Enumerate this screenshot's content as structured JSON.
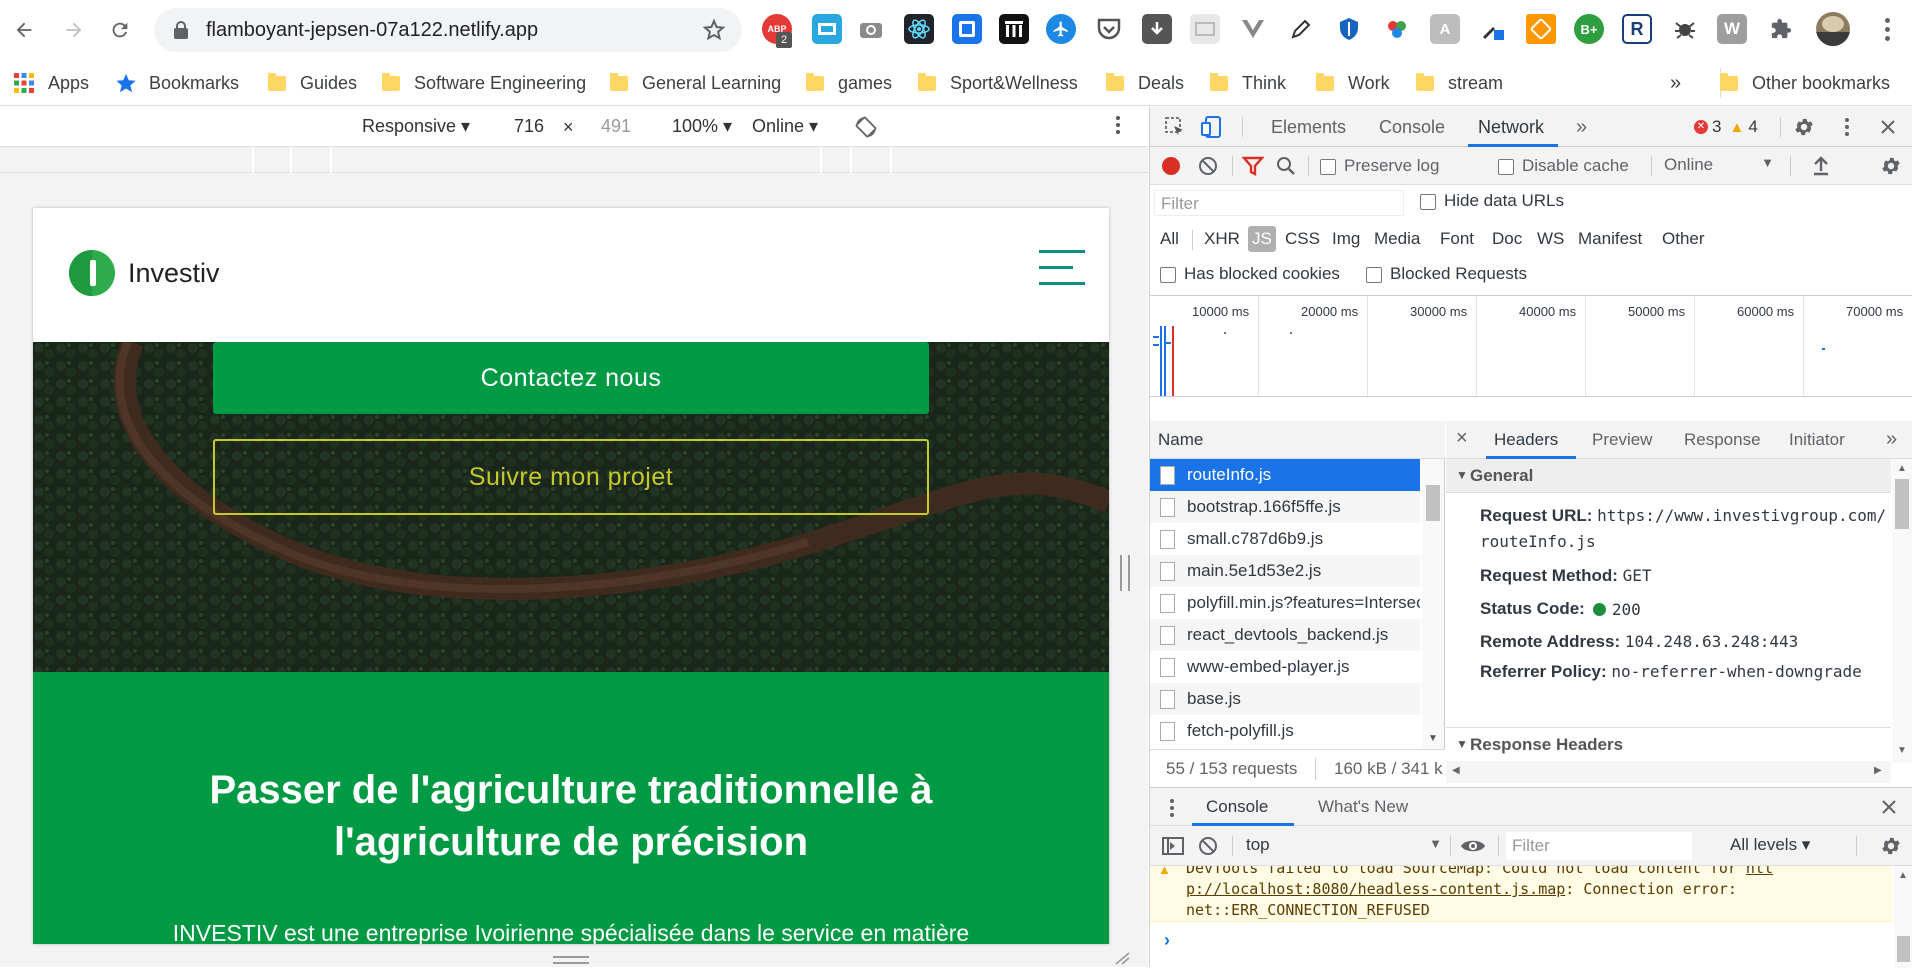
{
  "browser": {
    "url": "flamboyant-jepsen-07a122.netlify.app",
    "ext_badges": [
      {
        "name": "adblock",
        "text": "ABP",
        "badge": "2",
        "color": "#e53935"
      },
      {
        "name": "ext-2",
        "color": "#1a73e8"
      },
      {
        "name": "camera",
        "color": "#777"
      },
      {
        "name": "react-devtools",
        "color": "#222"
      },
      {
        "name": "ext-5",
        "color": "#1a73e8"
      },
      {
        "name": "ext-6",
        "color": "#222"
      },
      {
        "name": "ext-7",
        "color": "#1e88e5"
      },
      {
        "name": "pocket",
        "color": "#555"
      },
      {
        "name": "ext-9",
        "color": "#555"
      }
    ],
    "ext_letters": {
      "b_plus": "B+",
      "r": "R",
      "w": "W"
    }
  },
  "bookmarks": {
    "apps": "Apps",
    "bookmarks": "Bookmarks",
    "folders": [
      "Guides",
      "Software Engineering",
      "General Learning",
      "games",
      "Sport&Wellness",
      "Deals",
      "Think",
      "Work",
      "stream"
    ],
    "more": "»",
    "other": "Other bookmarks"
  },
  "device_toolbar": {
    "mode": "Responsive ▾",
    "width": "716",
    "times": "×",
    "height": "491",
    "zoom": "100% ▾",
    "network": "Online ▾"
  },
  "site": {
    "brand": "Investiv",
    "contact_btn": "Contactez nous",
    "follow_btn": "Suivre mon projet",
    "headline": "Passer de l'agriculture traditionnelle à l'agriculture de précision",
    "intro": "INVESTIV est une entreprise Ivoirienne spécialisée dans le service en matière"
  },
  "devtools": {
    "tabs": [
      "Elements",
      "Console",
      "Network"
    ],
    "active_tab": "Network",
    "more": "»",
    "errors": "3",
    "warnings": "4",
    "preserve_log": "Preserve log",
    "disable_cache": "Disable cache",
    "throttle": "Online",
    "filter_placeholder": "Filter",
    "hide_data_urls": "Hide data URLs",
    "types": [
      "All",
      "XHR",
      "JS",
      "CSS",
      "Img",
      "Media",
      "Font",
      "Doc",
      "WS",
      "Manifest",
      "Other"
    ],
    "active_type": "JS",
    "has_blocked_cookies": "Has blocked cookies",
    "blocked_requests": "Blocked Requests",
    "timeline_ticks": [
      "10000 ms",
      "20000 ms",
      "30000 ms",
      "40000 ms",
      "50000 ms",
      "60000 ms",
      "70000 ms"
    ],
    "name_header": "Name",
    "requests": [
      "routeInfo.js",
      "bootstrap.166f5ffe.js",
      "small.c787d6b9.js",
      "main.5e1d53e2.js",
      "polyfill.min.js?features=IntersectionObserver",
      "react_devtools_backend.js",
      "www-embed-player.js",
      "base.js",
      "fetch-polyfill.js"
    ],
    "selected_request": "routeInfo.js",
    "detail_close": "×",
    "detail_tabs": [
      "Headers",
      "Preview",
      "Response",
      "Initiator"
    ],
    "active_detail_tab": "Headers",
    "general": "General",
    "headers": [
      {
        "k": "Request URL:",
        "v": "https://www.investivgroup.com/routeInfo.js"
      },
      {
        "k": "Request Method:",
        "v": "GET"
      },
      {
        "k": "Status Code:",
        "v": "200"
      },
      {
        "k": "Remote Address:",
        "v": "104.248.63.248:443"
      },
      {
        "k": "Referrer Policy:",
        "v": "no-referrer-when-downgrade"
      }
    ],
    "response_headers": "Response Headers",
    "summary_requests": "55 / 153 requests",
    "summary_size": "160 kB / 341 k",
    "drawer_tabs": [
      "Console",
      "What's New"
    ],
    "context": "top",
    "console_filter": "Filter",
    "levels": "All levels ▾",
    "console_msg_1": "DevTools failed to load SourceMap: Could not load content for",
    "console_link_1": "htt",
    "console_link_2": "p://localhost:8080/headless-content.js.map",
    "console_msg_2": ": Connection error:",
    "console_msg_3": "net::ERR_CONNECTION_REFUSED",
    "prompt": "›"
  }
}
